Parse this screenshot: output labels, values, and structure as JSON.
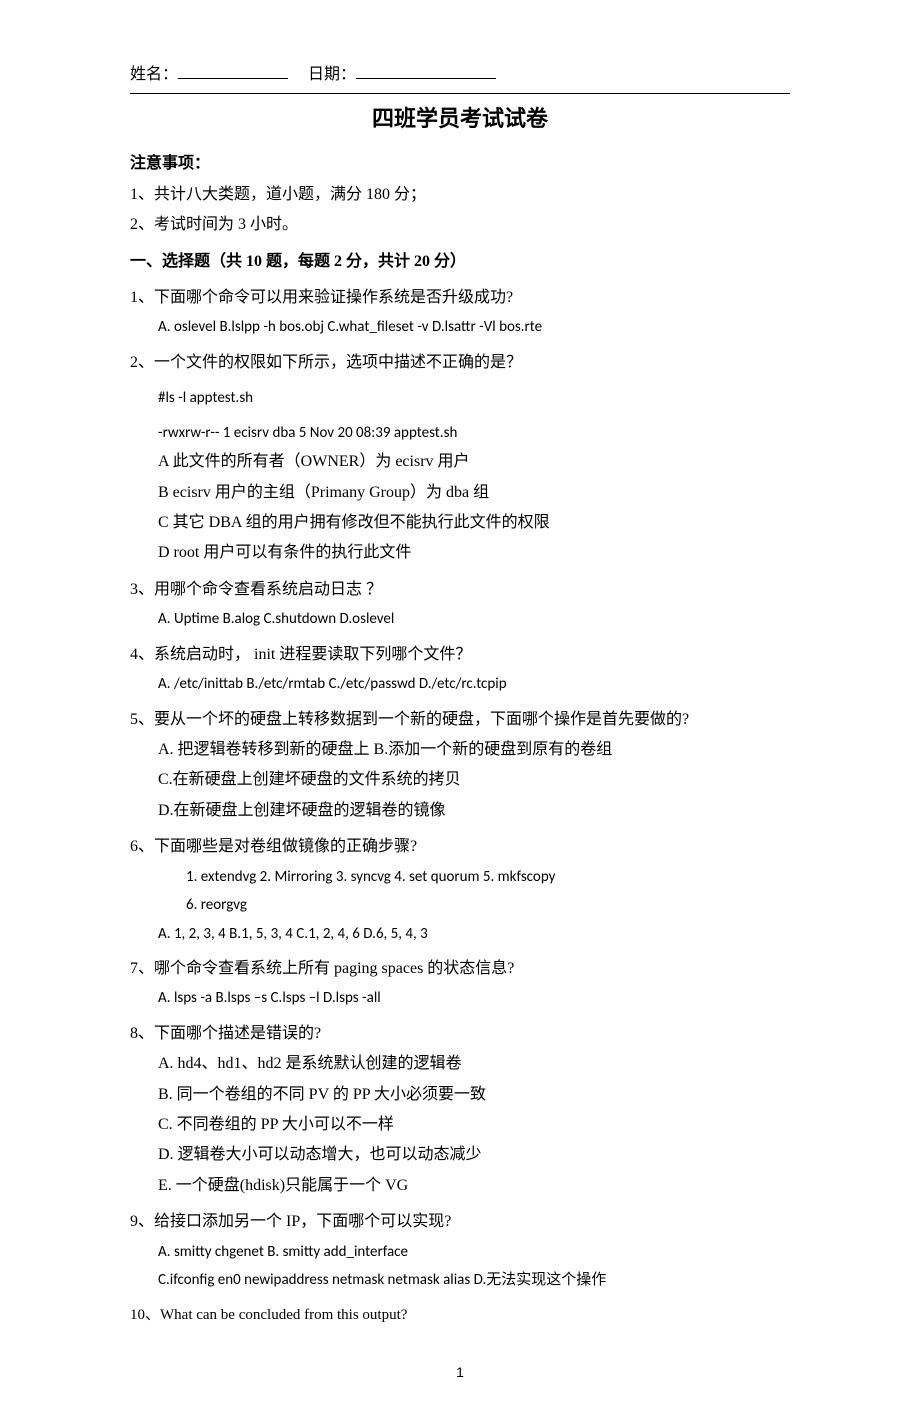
{
  "header": {
    "name_label": "姓名：",
    "date_label": "日期：",
    "title": "四班学员考试试卷"
  },
  "notice": {
    "heading": "注意事项：",
    "items": [
      "1、共计八大类题，道小题，满分 180 分；",
      "2、考试时间为 3 小时。"
    ]
  },
  "section1": {
    "heading": "一、选择题（共 10 题，每题 2 分，共计 20 分）"
  },
  "q1": {
    "text": "1、下面哪个命令可以用来验证操作系统是否升级成功?",
    "options": "A.   oslevel      B.lslpp -h bos.obj      C.what_fileset -v      D.lsattr -Vl bos.rte"
  },
  "q2": {
    "text": "2、一个文件的权限如下所示，选项中描述不正确的是？",
    "cmd": "#ls -l apptest.sh",
    "ls": "-rwxrw-r--       1 ecisrv           dba                           5 Nov 20 08:39 apptest.sh",
    "optA": "A 此文件的所有者（OWNER）为 ecisrv 用户",
    "optB": "B ecisrv 用户的主组（Primany Group）为 dba 组",
    "optC": "C 其它 DBA 组的用户拥有修改但不能执行此文件的权限",
    "optD": "D root 用户可以有条件的执行此文件"
  },
  "q3": {
    "text": "3、用哪个命令查看系统启动日志 ？",
    "options": "A.   Uptime    B.alog     C.shutdown     D.oslevel"
  },
  "q4": {
    "text": "4、系统启动时， init 进程要读取下列哪个文件？",
    "options": "A.   /etc/inittab      B./etc/rmtab     C./etc/passwd      D./etc/rc.tcpip"
  },
  "q5": {
    "text": "5、要从一个坏的硬盘上转移数据到一个新的硬盘，下面哪个操作是首先要做的?",
    "optAB": "A.   把逻辑卷转移到新的硬盘上    B.添加一个新的硬盘到原有的卷组",
    "optC": "C.在新硬盘上创建坏硬盘的文件系统的拷贝",
    "optD": "D.在新硬盘上创建坏硬盘的逻辑卷的镜像"
  },
  "q6": {
    "text": "6、下面哪些是对卷组做镜像的正确步骤?",
    "steps1": "1. extendvg    2. Mirroring    3. syncvg      4. set quorum    5. mkfscopy",
    "steps2": "6. reorgvg",
    "options": "A.    1, 2, 3, 4    B.1, 5, 3, 4        C.1, 2, 4, 6    D.6, 5, 4, 3"
  },
  "q7": {
    "text": "7、哪个命令查看系统上所有 paging spaces 的状态信息?",
    "options": "A.   lsps -a    B.lsps –s    C.lsps –l    D.lsps -all"
  },
  "q8": {
    "text": "8、下面哪个描述是错误的?",
    "optA": "A.   hd4、hd1、hd2 是系统默认创建的逻辑卷",
    "optB": "B.   同一个卷组的不同 PV 的 PP 大小必须要一致",
    "optC": "C.   不同卷组的 PP 大小可以不一样",
    "optD": "D.   逻辑卷大小可以动态增大，也可以动态减少",
    "optE": "E.   一个硬盘(hdisk)只能属于一个 VG"
  },
  "q9": {
    "text": "9、给接口添加另一个 IP，下面哪个可以实现?",
    "optAB": "A.   smitty chgenet    B. smitty add_interface",
    "optCD": "C.ifconfig en0 newipaddress netmask netmask alias    D.无法实现这个操作"
  },
  "q10": {
    "text": "10、What can be concluded from this output?"
  },
  "page_number": "1"
}
